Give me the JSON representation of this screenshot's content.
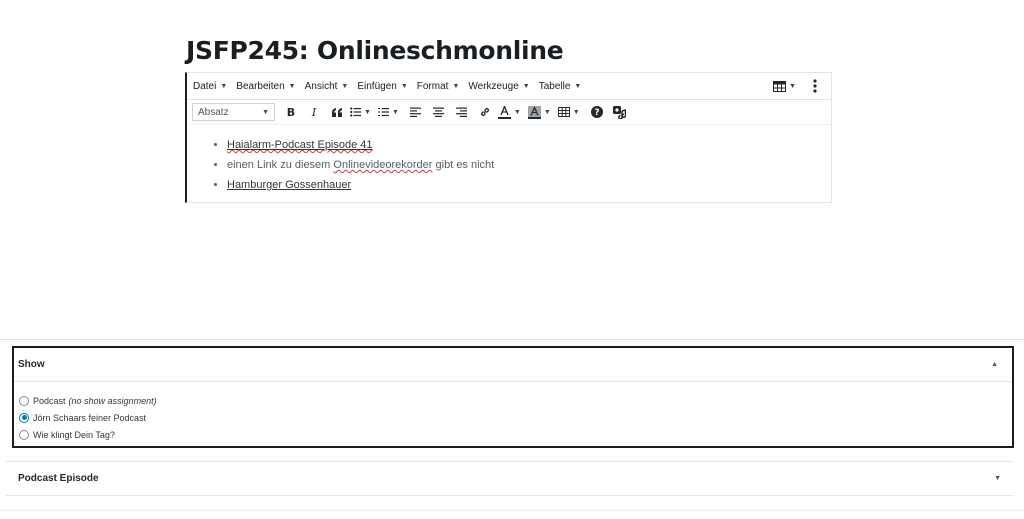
{
  "post": {
    "title": "JSFP245: Onlineschmonline"
  },
  "editor": {
    "menu": [
      {
        "label": "Datei"
      },
      {
        "label": "Bearbeiten"
      },
      {
        "label": "Ansicht"
      },
      {
        "label": "Einfügen"
      },
      {
        "label": "Format"
      },
      {
        "label": "Werkzeuge"
      },
      {
        "label": "Tabelle"
      }
    ],
    "format_select": {
      "value": "Absatz"
    },
    "toolbar_icons": [
      "bold-icon",
      "italic-icon",
      "blockquote-icon",
      "bullet-list-icon",
      "numbered-list-icon",
      "align-left-icon",
      "align-center-icon",
      "align-right-icon",
      "link-icon",
      "text-color-icon",
      "background-color-icon",
      "table-icon",
      "help-icon",
      "podcast-icon"
    ],
    "bold_label": "B",
    "italic_label": "I",
    "content": {
      "item1_link": "Haialarm-Podcast Episode 41",
      "item2_prefix": "einen Link zu diesem ",
      "item2_word": "Onlinevideorekorder",
      "item2_suffix": " gibt es nicht",
      "item3_link": "Hamburger Gossenhauer"
    }
  },
  "show_box": {
    "title": "Show",
    "options": [
      {
        "label": "Podcast",
        "note": "(no show assignment)",
        "checked": false
      },
      {
        "label": "Jörn Schaars feiner Podcast",
        "checked": true
      },
      {
        "label": "Wie klingt Dein Tag?",
        "checked": false
      }
    ]
  },
  "episode_box": {
    "title": "Podcast Episode"
  },
  "colors": {
    "accent": "#007cba",
    "spellcheck": "#d63638",
    "border_dark": "#191e23"
  }
}
